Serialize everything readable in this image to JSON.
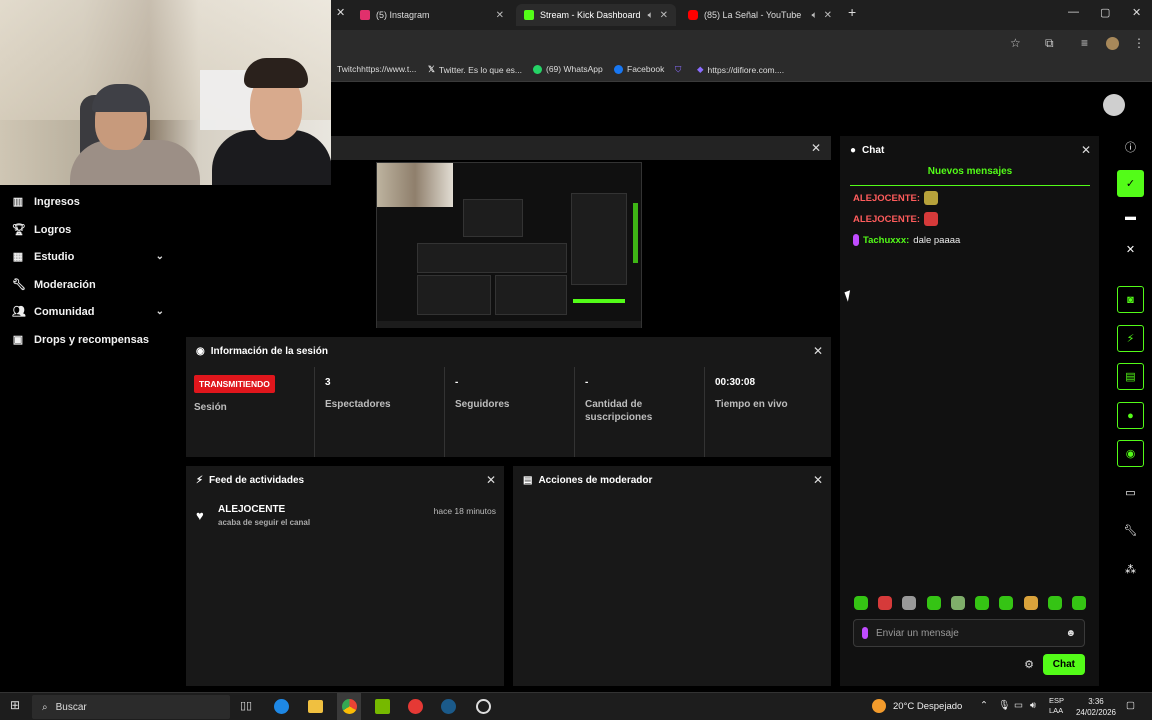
{
  "browser": {
    "tabs": [
      {
        "label": "(5) Instagram",
        "color": "#e1306c"
      },
      {
        "label": "Stream - Kick Dashboard",
        "color": "#53fc18"
      },
      {
        "label": "(85) La Señal - YouTube",
        "color": "#ff0000"
      }
    ],
    "bookmarks": [
      {
        "label": "Twitchhttps://www.t...",
        "color": "#9146ff"
      },
      {
        "label": "Twitter. Es lo que es...",
        "color": "#ffffff"
      },
      {
        "label": "(69) WhatsApp",
        "color": "#25d366"
      },
      {
        "label": "Facebook",
        "color": "#1877f2"
      },
      {
        "label": "https://difiore.com....",
        "color": "#8a6cff"
      }
    ]
  },
  "sidebar": {
    "items": [
      {
        "label": "Ingresos",
        "icon": "chart-icon"
      },
      {
        "label": "Logros",
        "icon": "trophy-icon"
      },
      {
        "label": "Estudio",
        "icon": "grid-icon"
      },
      {
        "label": "Moderación",
        "icon": "wrench-icon"
      },
      {
        "label": "Comunidad",
        "icon": "users-icon"
      },
      {
        "label": "Drops y recompensas",
        "icon": "gift-icon"
      }
    ]
  },
  "session": {
    "title": "Información de la sesión",
    "badge": "TRANSMITIENDO",
    "badge_label": "Sesión",
    "stats": [
      {
        "value": "3",
        "label": "Espectadores"
      },
      {
        "value": "-",
        "label": "Seguidores"
      },
      {
        "value": "-",
        "label": "Cantidad de suscripciones"
      },
      {
        "value": "00:30:08",
        "label": "Tiempo en vivo"
      }
    ]
  },
  "feed": {
    "title": "Feed de actividades",
    "item": {
      "name": "ALEJOCENTE",
      "action": "acaba de seguir el canal",
      "time": "hace 18 minutos"
    }
  },
  "mod": {
    "title": "Acciones de moderador"
  },
  "chat": {
    "title": "Chat",
    "new_messages": "Nuevos mensajes",
    "messages": [
      {
        "user": "ALEJOCENTE:",
        "text": "",
        "user_color": "#ff5c5c",
        "emote_color": "#b7a23b"
      },
      {
        "user": "ALEJOCENTE:",
        "text": "",
        "user_color": "#ff5c5c",
        "emote_color": "#d63a3a"
      },
      {
        "user": "Tachuxxx:",
        "text": "dale paaaa",
        "user_color": "#53fc18",
        "emote_color": "#c04cff"
      }
    ],
    "input_placeholder": "Enviar un mensaje",
    "send_label": "Chat"
  },
  "taskbar": {
    "search_label": "Buscar",
    "weather": "20°C Despejado",
    "lang_top": "ESP",
    "lang_bottom": "LAA",
    "time": "3:36",
    "date": "24/02/2026"
  },
  "colors": {
    "accent": "#53fc18",
    "live": "#e0161c"
  }
}
